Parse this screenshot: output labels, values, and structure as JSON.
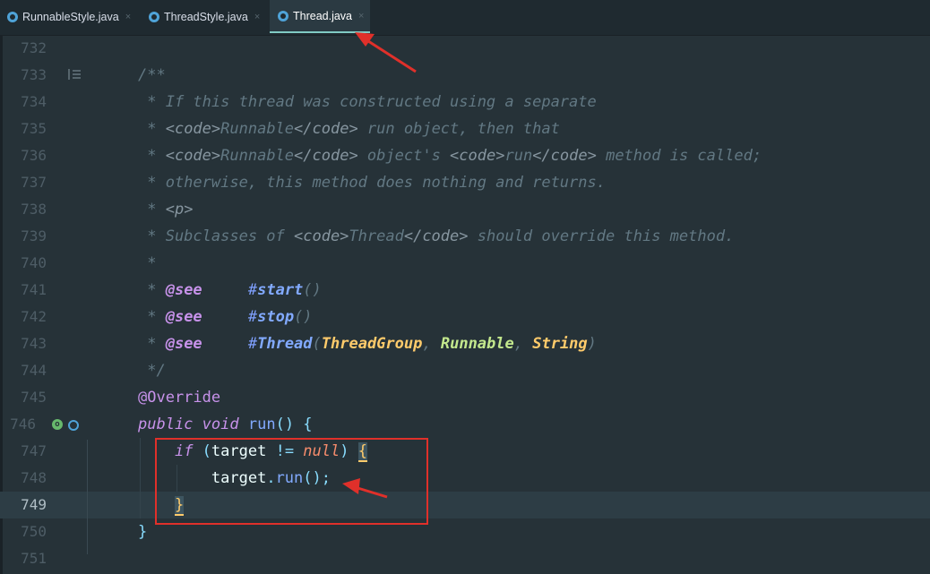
{
  "tabs": [
    {
      "label": "RunnableStyle.java",
      "close": "×",
      "active": false
    },
    {
      "label": "ThreadStyle.java",
      "close": "×",
      "active": false
    },
    {
      "label": "Thread.java",
      "close": "×",
      "active": true
    }
  ],
  "lines": [
    {
      "num": "732"
    },
    {
      "num": "733"
    },
    {
      "num": "734"
    },
    {
      "num": "735"
    },
    {
      "num": "736"
    },
    {
      "num": "737"
    },
    {
      "num": "738"
    },
    {
      "num": "739"
    },
    {
      "num": "740"
    },
    {
      "num": "741"
    },
    {
      "num": "742"
    },
    {
      "num": "743"
    },
    {
      "num": "744"
    },
    {
      "num": "745"
    },
    {
      "num": "746"
    },
    {
      "num": "747"
    },
    {
      "num": "748"
    },
    {
      "num": "749",
      "current": true
    },
    {
      "num": "750"
    },
    {
      "num": "751"
    }
  ],
  "code": {
    "l733": "/**",
    "l734": " * If this thread was constructed using a separate",
    "l735a": " * ",
    "l735b": "<code>",
    "l735c": "Runnable",
    "l735d": "</code>",
    "l735e": " run object, then that",
    "l736a": " * ",
    "l736b": "<code>",
    "l736c": "Runnable",
    "l736d": "</code>",
    "l736e": " object's ",
    "l736f": "<code>",
    "l736g": "run",
    "l736h": "</code>",
    "l736i": " method is called;",
    "l737": " * otherwise, this method does nothing and returns.",
    "l738a": " * ",
    "l738b": "<p>",
    "l739a": " * Subclasses of ",
    "l739b": "<code>",
    "l739c": "Thread",
    "l739d": "</code>",
    "l739e": " should override this method.",
    "l740": " *",
    "see_star": " * ",
    "see": "@see",
    "see_gap": "     ",
    "hash": "#",
    "start": "start",
    "stop": "stop",
    "thread_ref": "Thread",
    "parens": "()",
    "lp": "(",
    "rp": ")",
    "comma": ", ",
    "tg": "ThreadGroup",
    "runnable": "Runnable",
    "string": "String",
    "l744": " */",
    "override": "@Override",
    "public": "public",
    "void": "void",
    "run_sig": "run",
    "sig_rest": "() {",
    "indent1": "    ",
    "if_kw": "if",
    "if_lp": " (",
    "target": "target",
    "neq": " != ",
    "null": "null",
    "if_rp": ") ",
    "brace_open": "{",
    "indent2": "        ",
    "target2": "target",
    "dot": ".",
    "run_call": "run",
    "call_end": "();",
    "brace_close": "}",
    "outer_close": "}"
  },
  "gutter": {
    "override_badge": "o"
  }
}
